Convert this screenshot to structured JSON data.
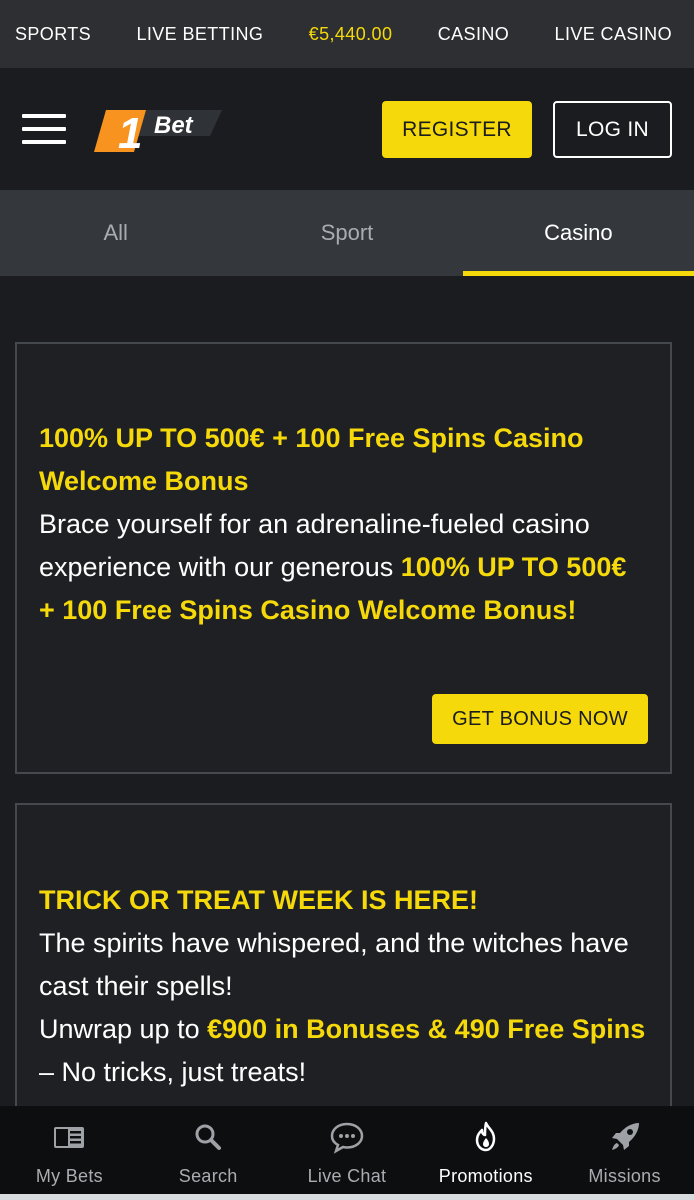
{
  "topnav": {
    "sports": "SPORTS",
    "live_betting": "LIVE BETTING",
    "balance": "€5,440.00",
    "casino": "CASINO",
    "live_casino": "LIVE CASINO"
  },
  "header": {
    "logo_text": "Bet",
    "logo_digit": "1",
    "register": "REGISTER",
    "login": "LOG IN"
  },
  "tabs": [
    {
      "label": "All",
      "active": false
    },
    {
      "label": "Sport",
      "active": false
    },
    {
      "label": "Casino",
      "active": true
    }
  ],
  "promos": [
    {
      "title": "100% UP TO 500€ + 100 Free Spins Casino Welcome Bonus",
      "text_before": "Brace yourself for an adrenaline-fueled casino experience with our generous ",
      "highlight": "100% UP TO 500€ + 100 Free Spins Casino Welcome Bonus!",
      "button": "GET BONUS NOW"
    },
    {
      "title": "TRICK OR TREAT WEEK IS HERE!",
      "line1": "The spirits have whispered, and the witches have cast their spells!",
      "line2_before": "Unwrap up to ",
      "highlight": "€900 in Bonuses & 490 Free Spins",
      "line2_after": " – No tricks, just treats!"
    }
  ],
  "bottomnav": [
    {
      "label": "My Bets",
      "icon": "my-bets-icon"
    },
    {
      "label": "Search",
      "icon": "search-icon"
    },
    {
      "label": "Live Chat",
      "icon": "chat-icon"
    },
    {
      "label": "Promotions",
      "icon": "flame-icon",
      "active": true
    },
    {
      "label": "Missions",
      "icon": "rocket-icon"
    }
  ],
  "colors": {
    "accent": "#f5d90a",
    "background": "#1a1c1f",
    "topbar": "#2d2f32",
    "tabbar": "#34383c"
  }
}
